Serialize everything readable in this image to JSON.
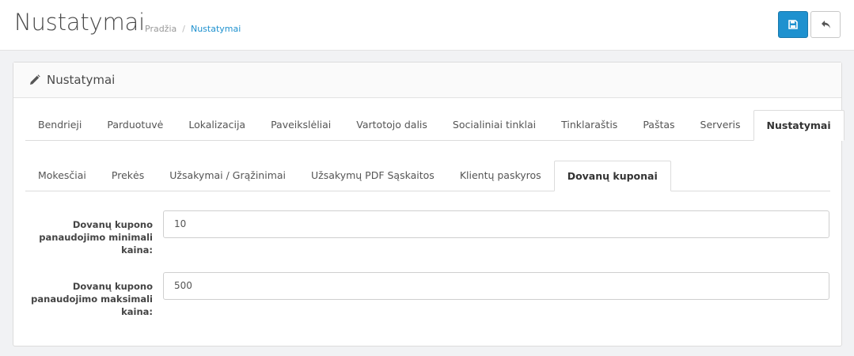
{
  "header": {
    "title": "Nustatymai",
    "breadcrumb": {
      "home": "Pradžia",
      "separator": "/",
      "current": "Nustatymai"
    },
    "save_icon": "floppy-disk-icon",
    "back_icon": "reply-arrow-icon"
  },
  "panel": {
    "icon": "pencil-icon",
    "title": "Nustatymai"
  },
  "main_tabs": [
    {
      "label": "Bendrieji"
    },
    {
      "label": "Parduotuvė"
    },
    {
      "label": "Lokalizacija"
    },
    {
      "label": "Paveikslėliai"
    },
    {
      "label": "Vartotojo dalis"
    },
    {
      "label": "Socialiniai tinklai"
    },
    {
      "label": "Tinklaraštis"
    },
    {
      "label": "Paštas"
    },
    {
      "label": "Serveris"
    },
    {
      "label": "Nustatymai"
    }
  ],
  "sub_tabs": [
    {
      "label": "Mokesčiai"
    },
    {
      "label": "Prekės"
    },
    {
      "label": "Užsakymai / Grąžinimai"
    },
    {
      "label": "Užsakymų PDF Sąskaitos"
    },
    {
      "label": "Klientų paskyros"
    },
    {
      "label": "Dovanų kuponai"
    }
  ],
  "form": {
    "min_label": "Dovanų kupono panaudojimo minimali kaina:",
    "min_value": "10",
    "max_label": "Dovanų kupono panaudojimo maksimali kaina:",
    "max_value": "500"
  },
  "colors": {
    "primary": "#1e91cf",
    "link": "#1e91cf"
  }
}
